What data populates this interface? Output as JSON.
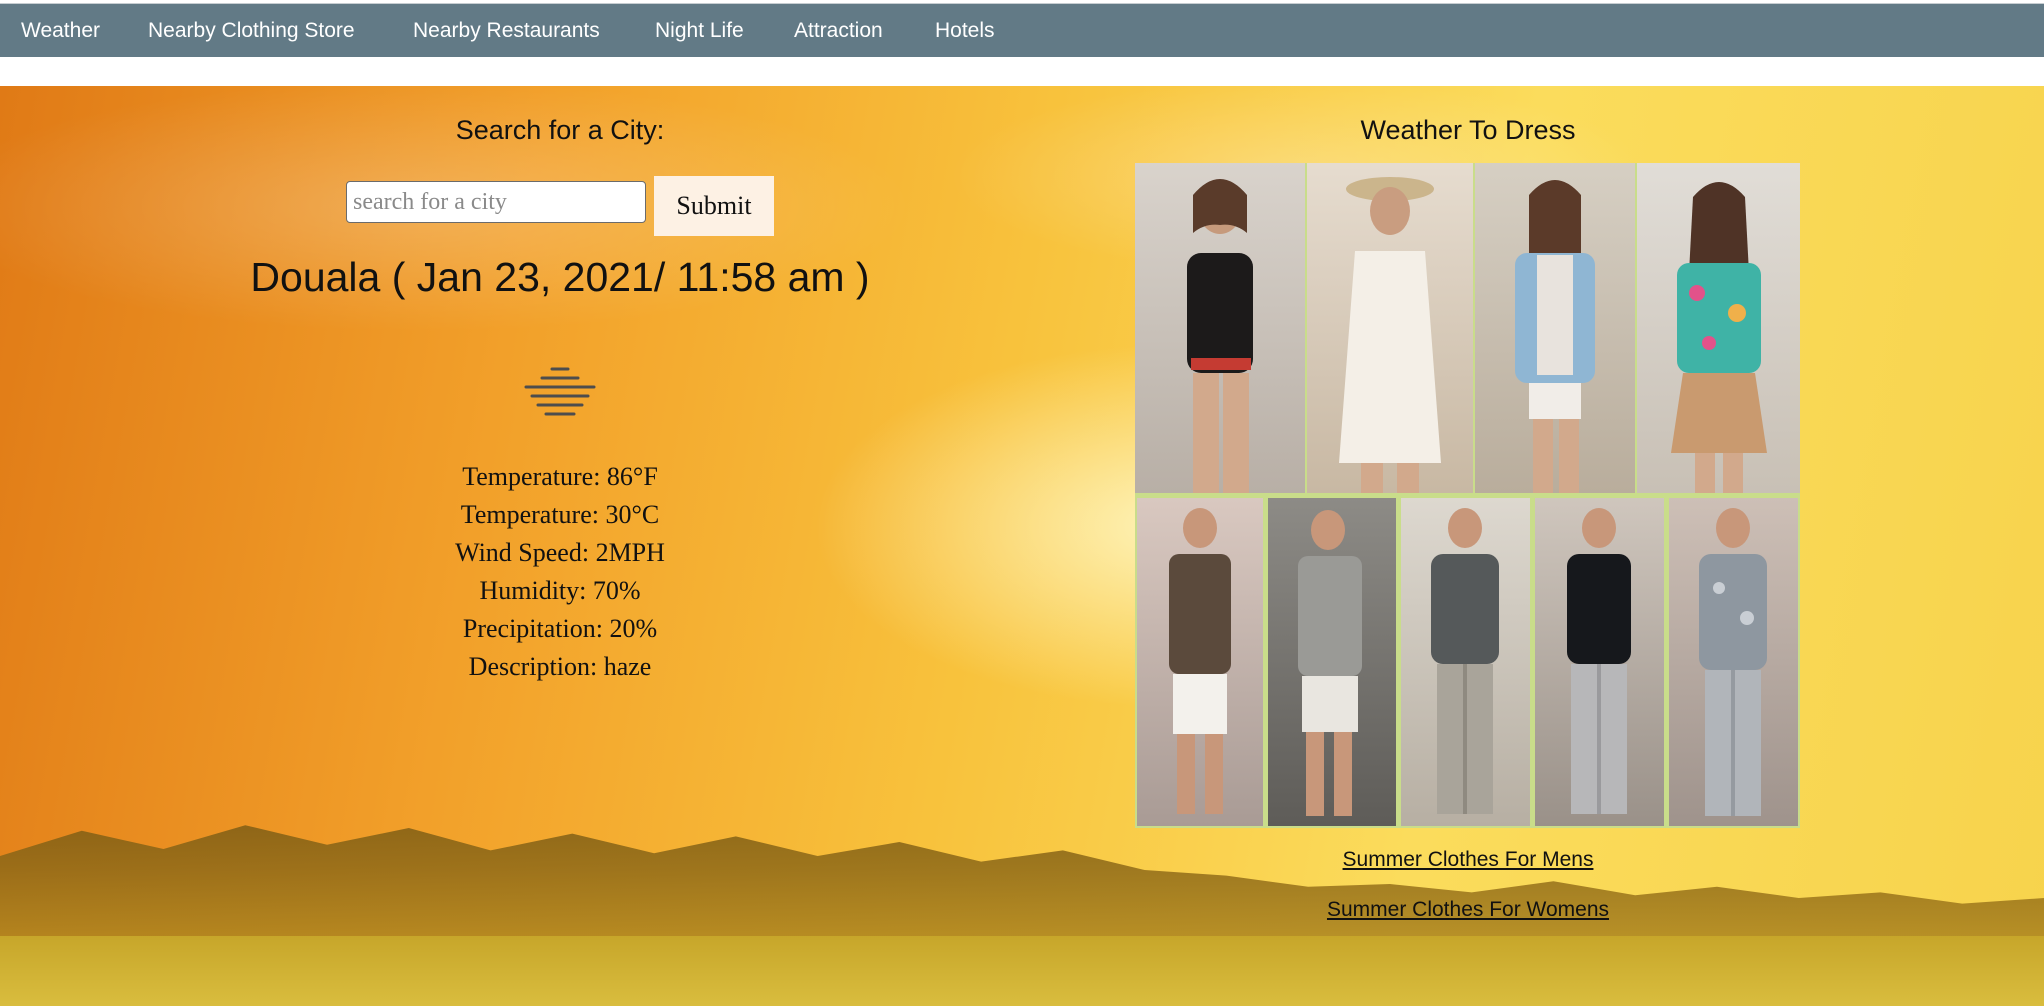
{
  "nav": {
    "items": [
      {
        "label": "Weather"
      },
      {
        "label": "Nearby Clothing Store"
      },
      {
        "label": "Nearby Restaurants"
      },
      {
        "label": "Night Life"
      },
      {
        "label": "Attraction"
      },
      {
        "label": "Hotels"
      }
    ]
  },
  "search": {
    "label": "Search for a City:",
    "placeholder": "search for a city",
    "value": "",
    "submit_label": "Submit"
  },
  "weather": {
    "title": "Douala ( Jan 23, 2021/ 11:58 am )",
    "icon": "haze-icon",
    "lines": [
      "Temperature: 86°F",
      "Temperature: 30°C",
      "Wind Speed: 2MPH",
      "Humidity: 70%",
      "Precipitation: 20%",
      "Description: haze"
    ]
  },
  "outfits": {
    "title": "Weather To Dress",
    "women_photos": [
      "woman-black-romper-photo",
      "woman-white-lace-dress-photo",
      "woman-denim-jacket-photo",
      "woman-floral-jacket-photo"
    ],
    "men_photos": [
      "man-patterned-shirt-shorts-photo",
      "man-grey-shirt-shorts-photo",
      "man-graphic-tee-photo",
      "man-black-tee-photo",
      "man-paisley-shirt-photo"
    ],
    "links": [
      "Summer Clothes For Mens",
      "Summer Clothes For Womens"
    ]
  },
  "colors": {
    "nav_bg": "#627a86",
    "nav_text": "#ffffff",
    "submit_bg": "#fdf1e4",
    "gallery_border": "#c9dd8a"
  }
}
